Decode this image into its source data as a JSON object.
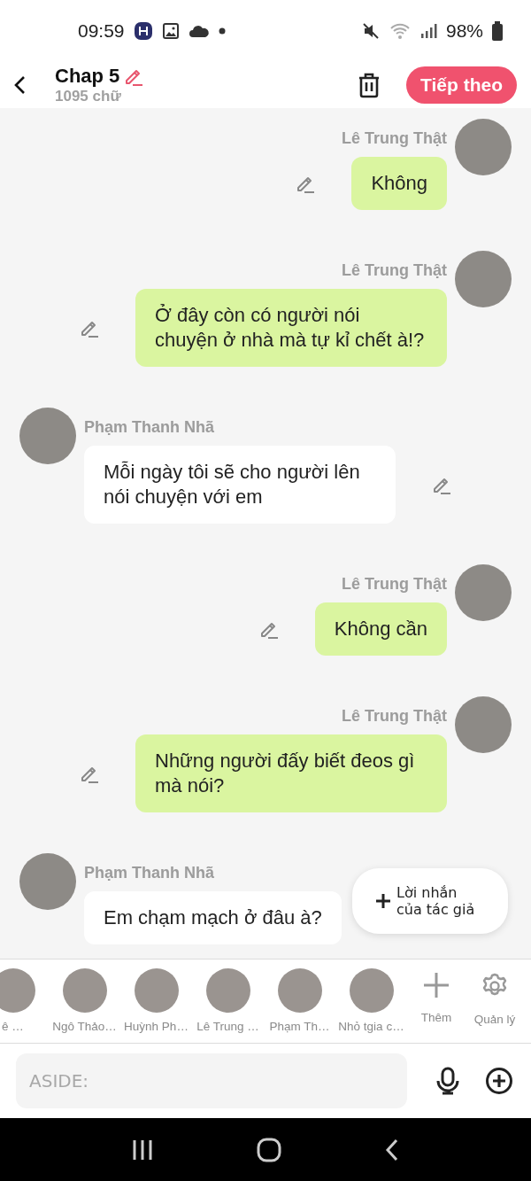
{
  "status_bar": {
    "time": "09:59",
    "battery": "98%"
  },
  "header": {
    "title": "Chap 5",
    "subtitle": "1095 chữ",
    "next_button": "Tiếp theo"
  },
  "messages": [
    {
      "kind": "outgoing",
      "speaker": "Lê Trung Thật",
      "text": "Không"
    },
    {
      "kind": "outgoing",
      "speaker": "Lê Trung Thật",
      "text": "Ở đây còn có người nói chuyện ở nhà mà tự kỉ chết à!?"
    },
    {
      "kind": "incoming",
      "speaker": "Phạm Thanh Nhã",
      "text": "Mỗi ngày tôi sẽ cho người lên nói chuyện với em"
    },
    {
      "kind": "outgoing",
      "speaker": "Lê Trung Thật",
      "text": "Không cần"
    },
    {
      "kind": "outgoing",
      "speaker": "Lê Trung Thật",
      "text": "Những người đấy biết đeos gì mà nói?"
    },
    {
      "kind": "incoming",
      "speaker": "Phạm Thanh Nhã",
      "text": "Em chạm mạch ở đâu à?"
    }
  ],
  "author_note_button": "Lời nhắn của tác giả",
  "characters": [
    {
      "kind": "character",
      "name": "ê …"
    },
    {
      "kind": "character",
      "name": "Ngô Thảo…"
    },
    {
      "kind": "character",
      "name": "Huỳnh Ph…"
    },
    {
      "kind": "character",
      "name": "Lê Trung …"
    },
    {
      "kind": "character",
      "name": "Phạm Th…"
    },
    {
      "kind": "character",
      "name": "Nhỏ tgia c…"
    },
    {
      "kind": "add",
      "name": "Thêm"
    },
    {
      "kind": "settings",
      "name": "Quản lý"
    }
  ],
  "composer": {
    "placeholder": "ASIDE:"
  }
}
